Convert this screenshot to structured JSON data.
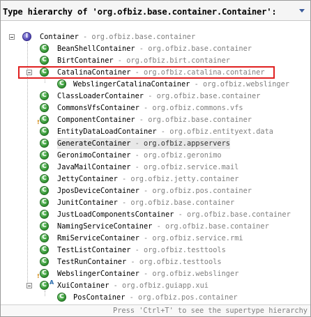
{
  "header": {
    "title": "Type hierarchy of 'org.ofbiz.base.container.Container':"
  },
  "tree": {
    "root": {
      "name": "Container",
      "sep": " - ",
      "pkg": "org.ofbiz.base.container"
    },
    "items": [
      {
        "name": "BeanShellContainer",
        "sep": " - ",
        "pkg": "org.ofbiz.base.container"
      },
      {
        "name": "BirtContainer",
        "sep": " - ",
        "pkg": "org.ofbiz.birt.container"
      },
      {
        "name": "CatalinaContainer",
        "sep": " - ",
        "pkg": "org.ofbiz.catalina.container"
      },
      {
        "name": "WebslingerCatalinaContainer",
        "sep": " - ",
        "pkg": "org.ofbiz.webslinger"
      },
      {
        "name": "ClassLoaderContainer",
        "sep": " - ",
        "pkg": "org.ofbiz.base.container"
      },
      {
        "name": "CommonsVfsContainer",
        "sep": " - ",
        "pkg": "org.ofbiz.commons.vfs"
      },
      {
        "name": "ComponentContainer",
        "sep": " - ",
        "pkg": "org.ofbiz.base.container"
      },
      {
        "name": "EntityDataLoadContainer",
        "sep": " - ",
        "pkg": "org.ofbiz.entityext.data"
      },
      {
        "name": "GenerateContainer",
        "sep": " - ",
        "pkg": "org.ofbiz.appservers"
      },
      {
        "name": "GeronimoContainer",
        "sep": " - ",
        "pkg": "org.ofbiz.geronimo"
      },
      {
        "name": "JavaMailContainer",
        "sep": " - ",
        "pkg": "org.ofbiz.service.mail"
      },
      {
        "name": "JettyContainer",
        "sep": " - ",
        "pkg": "org.ofbiz.jetty.container"
      },
      {
        "name": "JposDeviceContainer",
        "sep": " - ",
        "pkg": "org.ofbiz.pos.container"
      },
      {
        "name": "JunitContainer",
        "sep": " - ",
        "pkg": "org.ofbiz.base.container"
      },
      {
        "name": "JustLoadComponentsContainer",
        "sep": " - ",
        "pkg": "org.ofbiz.base.container"
      },
      {
        "name": "NamingServiceContainer",
        "sep": " - ",
        "pkg": "org.ofbiz.base.container"
      },
      {
        "name": "RmiServiceContainer",
        "sep": " - ",
        "pkg": "org.ofbiz.service.rmi"
      },
      {
        "name": "TestListContainer",
        "sep": " - ",
        "pkg": "org.ofbiz.testtools"
      },
      {
        "name": "TestRunContainer",
        "sep": " - ",
        "pkg": "org.ofbiz.testtools"
      },
      {
        "name": "WebslingerContainer",
        "sep": " - ",
        "pkg": "org.ofbiz.webslinger"
      },
      {
        "name": "XuiContainer",
        "sep": " - ",
        "pkg": "org.ofbiz.guiapp.xui"
      },
      {
        "name": "PosContainer",
        "sep": " - ",
        "pkg": "org.ofbiz.pos.container"
      }
    ]
  },
  "status": {
    "hint": "Press 'Ctrl+T' to see the supertype hierarchy"
  },
  "icons": {
    "root": "interface-icon",
    "item": "class-icon",
    "menu": "view-menu-icon"
  },
  "colors": {
    "highlight_box": "#e02020",
    "class_icon": "#2d8f2d",
    "interface_icon": "#4b3fb0"
  }
}
